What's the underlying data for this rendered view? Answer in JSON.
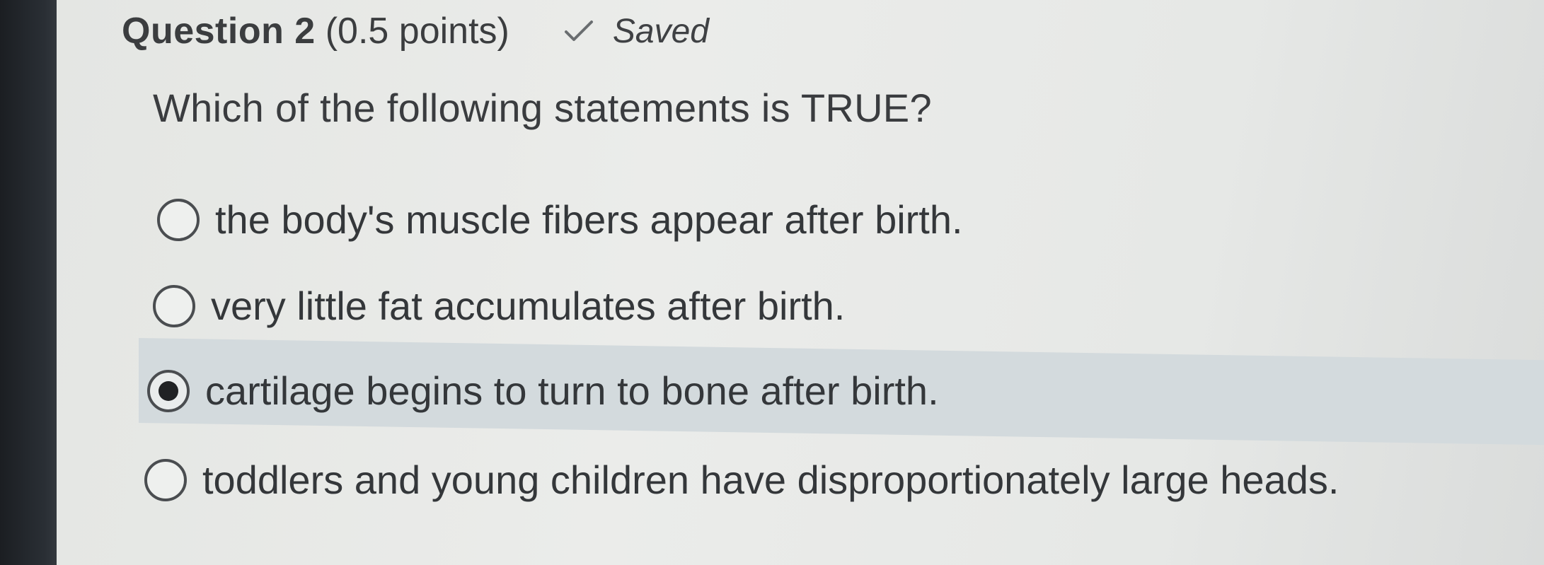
{
  "question": {
    "title": "Question 2",
    "points": "(0.5 points)",
    "status": "Saved",
    "status_icon": "check-icon",
    "prompt": "Which of the following statements is TRUE?"
  },
  "options": [
    {
      "label": "the body's muscle fibers appear after birth.",
      "selected": false
    },
    {
      "label": "very little fat accumulates after birth.",
      "selected": false
    },
    {
      "label": "cartilage begins to turn to bone after birth.",
      "selected": true
    },
    {
      "label": "toddlers and young children have disproportionately large heads.",
      "selected": false
    }
  ],
  "colors": {
    "text": "#3a3c3f",
    "selected_highlight": "#d3dadd",
    "background": "#e9eae8"
  }
}
